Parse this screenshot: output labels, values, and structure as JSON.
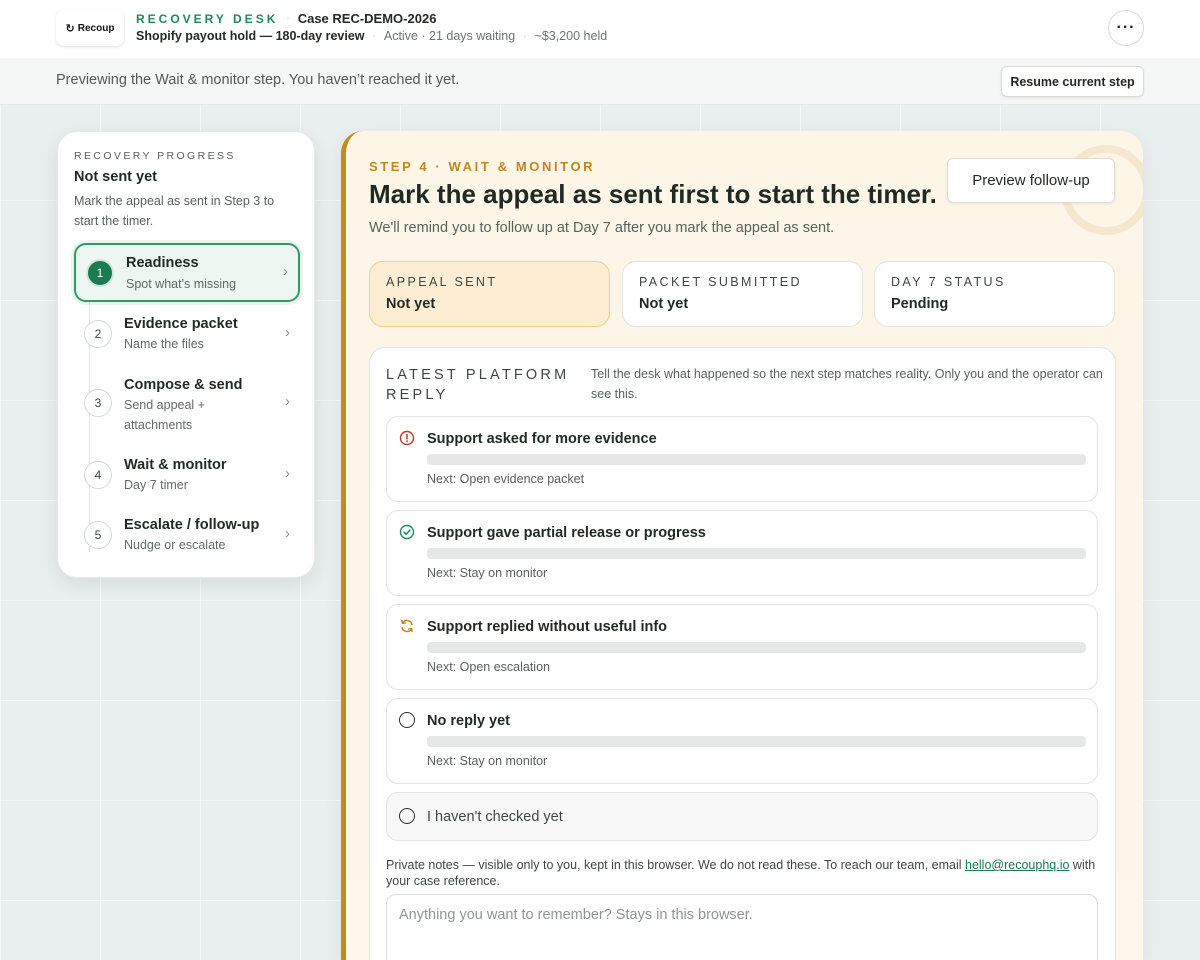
{
  "header": {
    "logo_text": "Recoup",
    "brand": "RECOVERY DESK",
    "case_id": "Case REC-DEMO-2026",
    "case_title": "Shopify payout hold — 180-day review",
    "status": "Active · 21 days waiting",
    "amount": "~$3,200 held",
    "more_label": "···"
  },
  "preview": {
    "text": "Previewing the Wait & monitor step. You haven’t reached it yet.",
    "resume_label": "Resume current step"
  },
  "progress": {
    "eyebrow": "RECOVERY PROGRESS",
    "status": "Not sent yet",
    "description": "Mark the appeal as sent in Step 3 to start the timer.",
    "steps": [
      {
        "num": "1",
        "title": "Readiness",
        "sub": "Spot what's missing",
        "active": true
      },
      {
        "num": "2",
        "title": "Evidence packet",
        "sub": "Name the files",
        "active": false
      },
      {
        "num": "3",
        "title": "Compose & send",
        "sub": "Send appeal + attachments",
        "active": false
      },
      {
        "num": "4",
        "title": "Wait & monitor",
        "sub": "Day 7 timer",
        "active": false
      },
      {
        "num": "5",
        "title": "Escalate / follow-up",
        "sub": "Nudge or escalate",
        "active": false
      }
    ]
  },
  "main": {
    "eyebrow": "STEP 4 · WAIT & MONITOR",
    "title": "Mark the appeal as sent first to start the timer.",
    "description": "We'll remind you to follow up at Day 7 after you mark the appeal as sent.",
    "followup_label": "Preview follow-up",
    "stats": [
      {
        "label": "APPEAL SENT",
        "value": "Not yet"
      },
      {
        "label": "PACKET SUBMITTED",
        "value": "Not yet"
      },
      {
        "label": "DAY 7 STATUS",
        "value": "Pending"
      }
    ]
  },
  "reply": {
    "heading": "LATEST PLATFORM REPLY",
    "description": "Tell the desk what happened so the next step matches reality. Only you and the operator can see this.",
    "options": [
      {
        "icon": "alert-circle-icon",
        "title": "Support asked for more evidence",
        "next": "Next: Open evidence packet"
      },
      {
        "icon": "check-circle-icon",
        "title": "Support gave partial release or progress",
        "next": "Next: Stay on monitor"
      },
      {
        "icon": "refresh-icon",
        "title": "Support replied without useful info",
        "next": "Next: Open escalation"
      },
      {
        "icon": "radio-icon",
        "title": "No reply yet",
        "next": "Next: Stay on monitor"
      }
    ],
    "not_checked": "I haven't checked yet",
    "notes_prefix": "Private notes — visible only to you, kept in this browser. We do not read these. To reach our team, email ",
    "notes_email": "hello@recouphq.io",
    "notes_suffix": " with your case reference.",
    "notes_placeholder": "Anything you want to remember? Stays in this browser."
  },
  "colors": {
    "brand_green": "#1f8a5a",
    "accent_amber": "#c58a1d",
    "alert_red": "#c0392b"
  }
}
